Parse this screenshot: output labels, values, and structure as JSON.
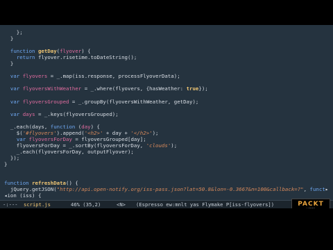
{
  "editor": {
    "lines": [
      [
        {
          "t": "    };",
          "c": "pl"
        }
      ],
      [
        {
          "t": "  }",
          "c": "pl"
        }
      ],
      [
        {
          "t": "",
          "c": "pl"
        }
      ],
      [
        {
          "t": "  ",
          "c": "pl"
        },
        {
          "t": "function",
          "c": "kw"
        },
        {
          "t": " ",
          "c": "pl"
        },
        {
          "t": "getDay",
          "c": "fn"
        },
        {
          "t": "(",
          "c": "pl"
        },
        {
          "t": "flyover",
          "c": "var"
        },
        {
          "t": ") {",
          "c": "pl"
        }
      ],
      [
        {
          "t": "    ",
          "c": "pl"
        },
        {
          "t": "return",
          "c": "kw"
        },
        {
          "t": " flyover.risetime.toDateString();",
          "c": "pl"
        }
      ],
      [
        {
          "t": "  }",
          "c": "pl"
        }
      ],
      [
        {
          "t": "",
          "c": "pl"
        }
      ],
      [
        {
          "t": "  ",
          "c": "pl"
        },
        {
          "t": "var",
          "c": "kw"
        },
        {
          "t": " ",
          "c": "pl"
        },
        {
          "t": "flyovers",
          "c": "var"
        },
        {
          "t": " = _.map(iss.response, processFlyoverData);",
          "c": "pl"
        }
      ],
      [
        {
          "t": "",
          "c": "pl"
        }
      ],
      [
        {
          "t": "  ",
          "c": "pl"
        },
        {
          "t": "var",
          "c": "kw"
        },
        {
          "t": " ",
          "c": "pl"
        },
        {
          "t": "flyoversWithWeather",
          "c": "var"
        },
        {
          "t": " = _.where(flyovers, {hasWeather: ",
          "c": "pl"
        },
        {
          "t": "true",
          "c": "fn"
        },
        {
          "t": "});",
          "c": "pl"
        }
      ],
      [
        {
          "t": "",
          "c": "pl"
        }
      ],
      [
        {
          "t": "  ",
          "c": "pl"
        },
        {
          "t": "var",
          "c": "kw"
        },
        {
          "t": " ",
          "c": "pl"
        },
        {
          "t": "flyoversGrouped",
          "c": "var"
        },
        {
          "t": " = _.groupBy(flyoversWithWeather, getDay);",
          "c": "pl"
        }
      ],
      [
        {
          "t": "",
          "c": "pl"
        }
      ],
      [
        {
          "t": "  ",
          "c": "pl"
        },
        {
          "t": "var",
          "c": "kw"
        },
        {
          "t": " ",
          "c": "pl"
        },
        {
          "t": "days",
          "c": "var"
        },
        {
          "t": " = _.keys(flyoversGrouped);",
          "c": "pl"
        }
      ],
      [
        {
          "t": "",
          "c": "pl"
        }
      ],
      [
        {
          "t": "  _.each(days, ",
          "c": "pl"
        },
        {
          "t": "function",
          "c": "kw"
        },
        {
          "t": " (",
          "c": "pl"
        },
        {
          "t": "day",
          "c": "var"
        },
        {
          "t": ") {",
          "c": "pl"
        }
      ],
      [
        {
          "t": "    $(",
          "c": "pl"
        },
        {
          "t": "'#flyovers'",
          "c": "str it"
        },
        {
          "t": ").append(",
          "c": "pl"
        },
        {
          "t": "'<h2>'",
          "c": "str it"
        },
        {
          "t": " + day + ",
          "c": "pl"
        },
        {
          "t": "'</h2>'",
          "c": "str it"
        },
        {
          "t": ");",
          "c": "pl"
        }
      ],
      [
        {
          "t": "    ",
          "c": "pl"
        },
        {
          "t": "var",
          "c": "kw"
        },
        {
          "t": " ",
          "c": "pl"
        },
        {
          "t": "flyoversForDay",
          "c": "var"
        },
        {
          "t": " = flyoversGrouped[day];",
          "c": "pl"
        }
      ],
      [
        {
          "t": "    flyoversForDay = _.sortBy(flyoversForDay, ",
          "c": "pl"
        },
        {
          "t": "'clouds'",
          "c": "str it"
        },
        {
          "t": ");",
          "c": "pl"
        }
      ],
      [
        {
          "t": "    _.each(flyoversForDay, outputFlyover);",
          "c": "pl"
        }
      ],
      [
        {
          "t": "  });",
          "c": "pl"
        }
      ],
      [
        {
          "t": "}",
          "c": "pl"
        }
      ],
      [
        {
          "t": "",
          "c": "pl"
        }
      ],
      [
        {
          "t": "",
          "c": "pl"
        }
      ],
      [
        {
          "t": "function",
          "c": "kw"
        },
        {
          "t": " ",
          "c": "pl"
        },
        {
          "t": "refreshData",
          "c": "fn"
        },
        {
          "t": "() {",
          "c": "pl"
        }
      ],
      [
        {
          "t": "  jQuery.getJSON(",
          "c": "pl"
        },
        {
          "t": "\"http://api.open-notify.org/iss-pass.json?lat=50.8&lon=-0.3667&n=100&callback=?\"",
          "c": "str it"
        },
        {
          "t": ", ",
          "c": "pl"
        },
        {
          "t": "funct",
          "c": "kw"
        },
        {
          "t": "▸",
          "c": "pl"
        }
      ],
      [
        {
          "t": "◂ion (iss) {",
          "c": "pl"
        }
      ]
    ]
  },
  "modeline": {
    "flags": "-:---",
    "filename": "script.js",
    "position": "46% (35,2)",
    "mode_indicator": "<N>",
    "modes": "(Espresso ew:mnlt yas Flymake P[iss-flyovers])"
  },
  "logo": {
    "main": "PACKT",
    "sub": "VIDEO"
  }
}
